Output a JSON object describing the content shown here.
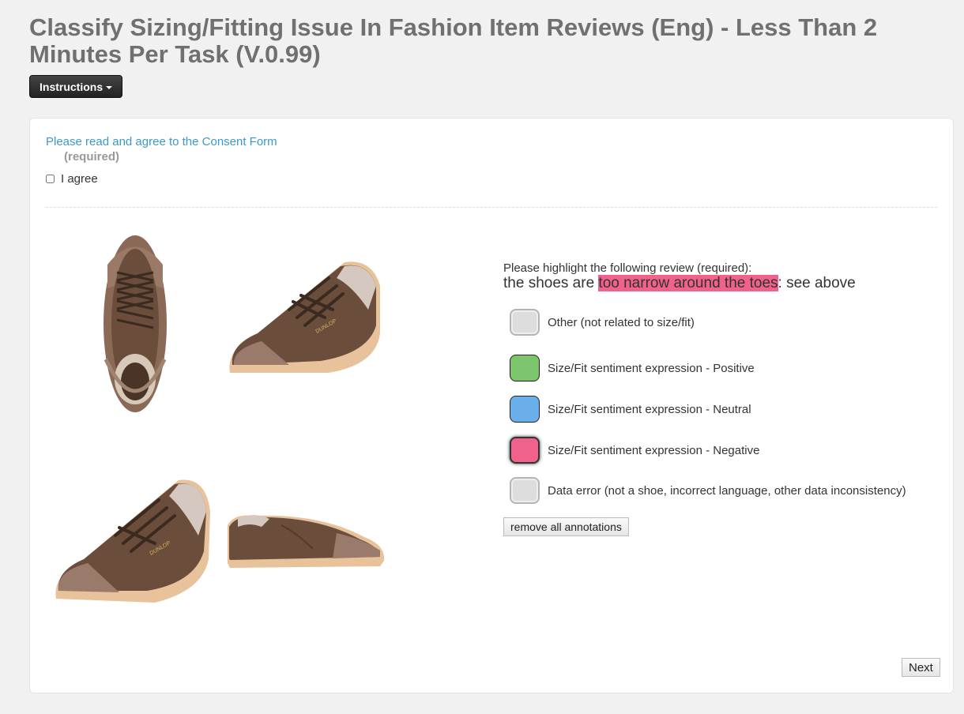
{
  "page": {
    "title": "Classify Sizing/Fitting Issue In Fashion Item Reviews (Eng) - Less Than 2 Minutes Per Task (V.0.99)"
  },
  "toolbar": {
    "instructions_label": "Instructions"
  },
  "consent": {
    "link_text": "Please read and agree to the Consent Form",
    "required_text": "(required)",
    "agree_label": "I agree",
    "checked": false
  },
  "review": {
    "prompt": "Please highlight the following review (required):",
    "text_before": "the shoes are ",
    "highlighted_text": "too narrow around the toes",
    "text_after": ": see above",
    "highlight_color": "#f0628c"
  },
  "labels": [
    {
      "text": "Other (not related to size/fit)",
      "color": "#dddddd",
      "border": "#b5b5b5"
    },
    {
      "text": "Size/Fit sentiment expression - Positive",
      "color": "#7dc56c",
      "border": "#222222"
    },
    {
      "text": "Size/Fit sentiment expression - Neutral",
      "color": "#6aaeea",
      "border": "#222222"
    },
    {
      "text": "Size/Fit sentiment expression - Negative",
      "color": "#f0628c",
      "border": "#222222"
    },
    {
      "text": "Data error (not a shoe, incorrect language, other data inconsistency)",
      "color": "#dddddd",
      "border": "#b5b5b5"
    }
  ],
  "buttons": {
    "remove_all": "remove all annotations",
    "next": "Next"
  },
  "images": {
    "product": "brown suede sneaker",
    "brand_on_shoe": "DUNLOP"
  }
}
